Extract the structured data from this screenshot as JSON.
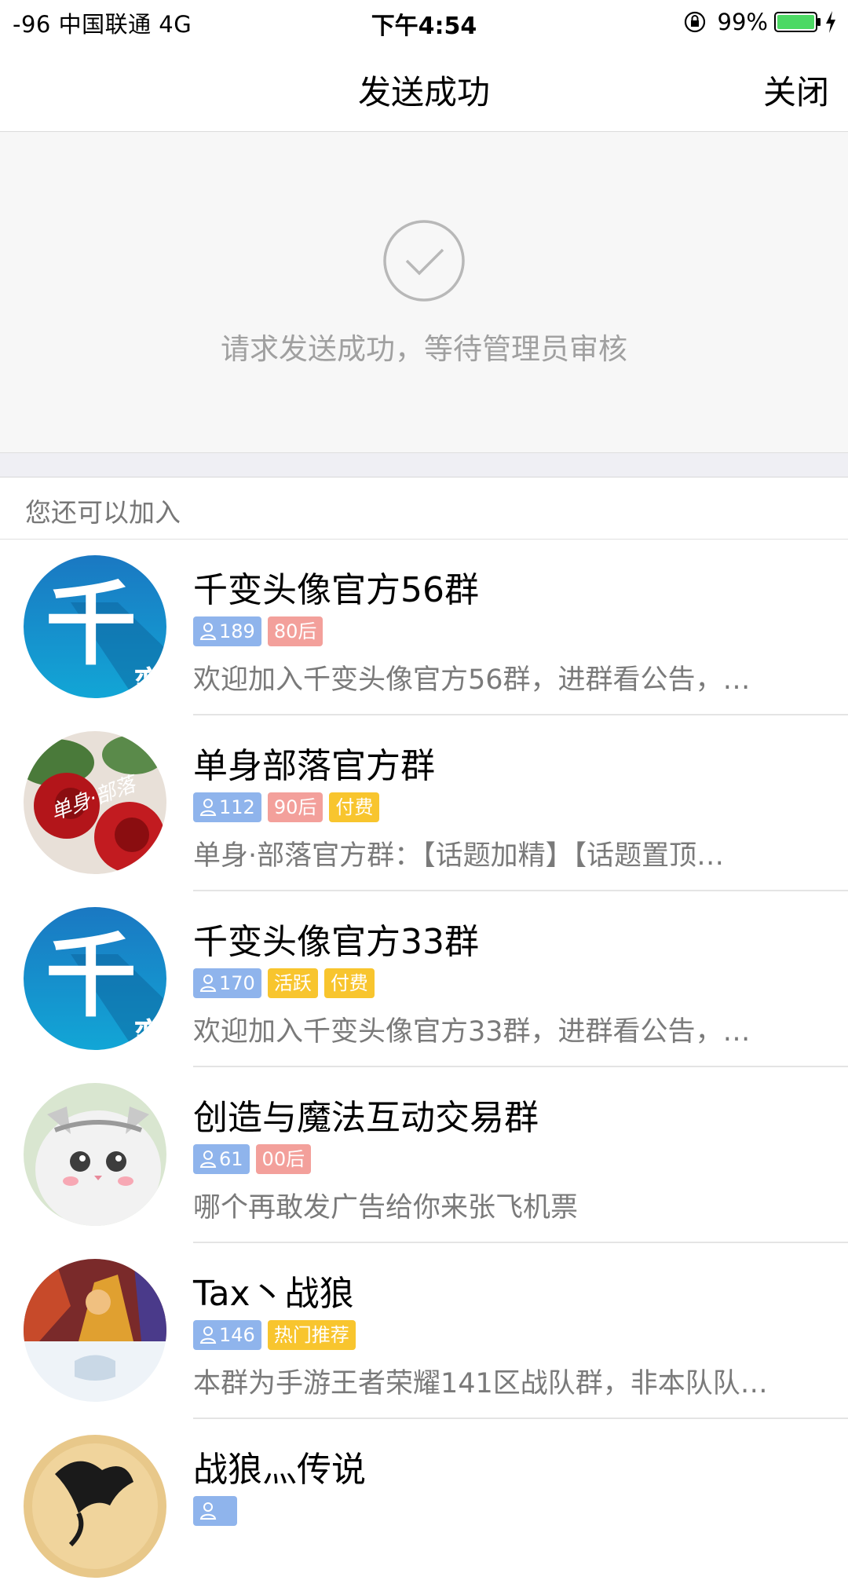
{
  "status_bar": {
    "carrier": "-96 中国联通   4G",
    "time": "下午4:54",
    "battery": "99%"
  },
  "nav": {
    "title": "发送成功",
    "close_label": "关闭"
  },
  "success": {
    "message": "请求发送成功，等待管理员审核"
  },
  "section": {
    "title": "您还可以加入"
  },
  "groups": [
    {
      "name": "千变头像官方56群",
      "members": "189",
      "tags": [
        "80后"
      ],
      "desc": "欢迎加入千变头像官方56群，进群看公告，…"
    },
    {
      "name": "单身部落官方群",
      "members": "112",
      "tags": [
        "90后",
        "付费"
      ],
      "desc": " 单身·部落官方群：【话题加精】【话题置顶…"
    },
    {
      "name": "千变头像官方33群",
      "members": "170",
      "tags": [
        "活跃",
        "付费"
      ],
      "desc": "欢迎加入千变头像官方33群，进群看公告，…"
    },
    {
      "name": "创造与魔法互动交易群",
      "members": "61",
      "tags": [
        "00后"
      ],
      "desc": "哪个再敢发广告给你来张飞机票"
    },
    {
      "name": "Tax丶战狼",
      "members": "146",
      "tags": [
        "热门推荐"
      ],
      "desc": "本群为手游王者荣耀141区战队群，非本队队…"
    },
    {
      "name": "战狼灬传说",
      "members": "",
      "tags": [],
      "desc": ""
    }
  ],
  "avatar_text": {
    "qianbian_char": "千",
    "qianbian_sub": "变",
    "danshen_overlay": "单身·部落"
  },
  "colors": {
    "member_tag": "#8fb4ec",
    "age_tag": "#f3a09b",
    "yellow_tag": "#f8c52e",
    "battery": "#4cd964"
  },
  "icons": [
    "lock-rotation-icon",
    "battery-icon",
    "charging-icon",
    "checkmark-circle-icon",
    "person-icon"
  ]
}
